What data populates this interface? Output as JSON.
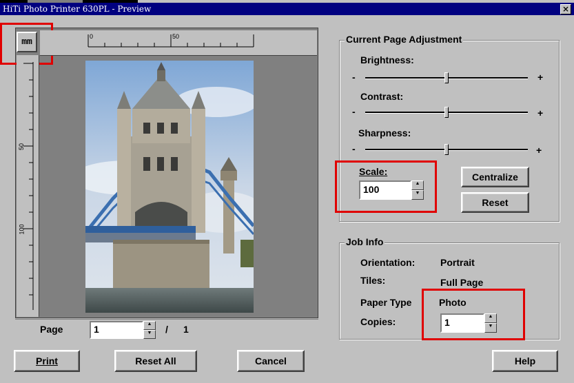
{
  "window": {
    "title": "HiTi Photo Printer 630PL - Preview",
    "close": "×"
  },
  "ruler": {
    "unit": "mm",
    "h_labels": [
      "0",
      "50"
    ],
    "v_labels": [
      "50",
      "100"
    ]
  },
  "photo": {
    "alt": "Tower Bridge, London"
  },
  "page": {
    "label": "Page",
    "current": "1",
    "separator": "/",
    "total": "1"
  },
  "adjust": {
    "group": "Current Page Adjustment",
    "brightness": {
      "label": "Brightness:",
      "minus": "-",
      "plus": "+",
      "value": 0.5
    },
    "contrast": {
      "label": "Contrast:",
      "minus": "-",
      "plus": "+",
      "value": 0.5
    },
    "sharpness": {
      "label": "Sharpness:",
      "minus": "-",
      "plus": "+",
      "value": 0.5
    },
    "scale": {
      "label": "Scale:",
      "value": "100"
    },
    "centralize": "Centralize",
    "reset": "Reset"
  },
  "job": {
    "group": "Job Info",
    "orientation_label": "Orientation:",
    "orientation": "Portrait",
    "tiles_label": "Tiles:",
    "tiles": "Full Page",
    "paper_label": "Paper Type",
    "paper": "Photo",
    "copies_label": "Copies:",
    "copies": "1"
  },
  "buttons": {
    "print": "Print",
    "reset_all": "Reset All",
    "cancel": "Cancel",
    "help": "Help"
  },
  "colors": {
    "highlight": "#e00000",
    "title": "#000080"
  }
}
